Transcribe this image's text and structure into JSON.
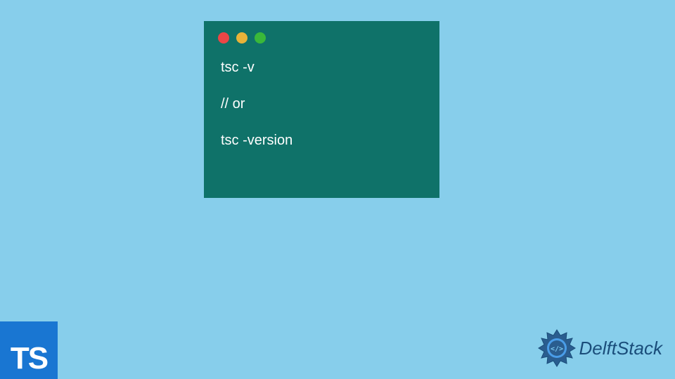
{
  "terminal": {
    "lines": [
      "tsc -v",
      "// or",
      "tsc -version"
    ]
  },
  "ts_badge": {
    "label": "TS"
  },
  "brand": {
    "name": "DelftStack"
  },
  "colors": {
    "background": "#87ceeb",
    "terminal_bg": "#0f7269",
    "ts_badge_bg": "#1976d2",
    "brand_color": "#1a4d7a"
  }
}
